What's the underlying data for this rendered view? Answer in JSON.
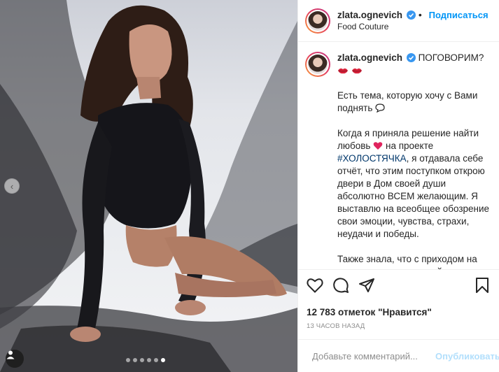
{
  "post": {
    "username": "zlata.ognevich",
    "follow_label": "Подписаться",
    "location": "Food Couture",
    "caption_title": "ПОГОВОРИМ?",
    "caption_p1": "Есть тема, которую хочу с Вами поднять",
    "caption_p2_a": "Когда я приняла решение найти любовь",
    "caption_p2_b": "на проекте",
    "hashtag": "#ХОЛОСТЯЧКА",
    "caption_p2_c": ", я отдавала себе отчёт, что этим поступком открою двери в Дом своей души абсолютно ВСЕМ желающим. Я выставлю на всеобщее обозрение свои эмоции, чувства, страхи, неудачи и победы.",
    "caption_p3": "Также знала, что с приходом на проект, я расскажу свой путь, в котором кто-то увидит повод для хейта, а кто-то- повод для мотивации",
    "likes": "12 783 отметок \"Нравится\"",
    "time": "13 ЧАСОВ НАЗАД",
    "comment_placeholder": "Добавьте комментарий...",
    "publish_label": "Опубликовать"
  },
  "carousel": {
    "total": 6,
    "active": 5
  },
  "colors": {
    "accent": "#0095f6",
    "hashtag": "#00376b",
    "publish_disabled": "#b2dffc",
    "heart_red": "#e0245e"
  },
  "icons": [
    "verified-badge-icon",
    "lips-emoji-icon",
    "speech-bubble-emoji-icon",
    "heart-emoji-icon",
    "heart-icon",
    "comment-icon",
    "share-icon",
    "bookmark-icon",
    "emoji-smile-icon",
    "chevron-left-icon",
    "user-tag-icon"
  ]
}
